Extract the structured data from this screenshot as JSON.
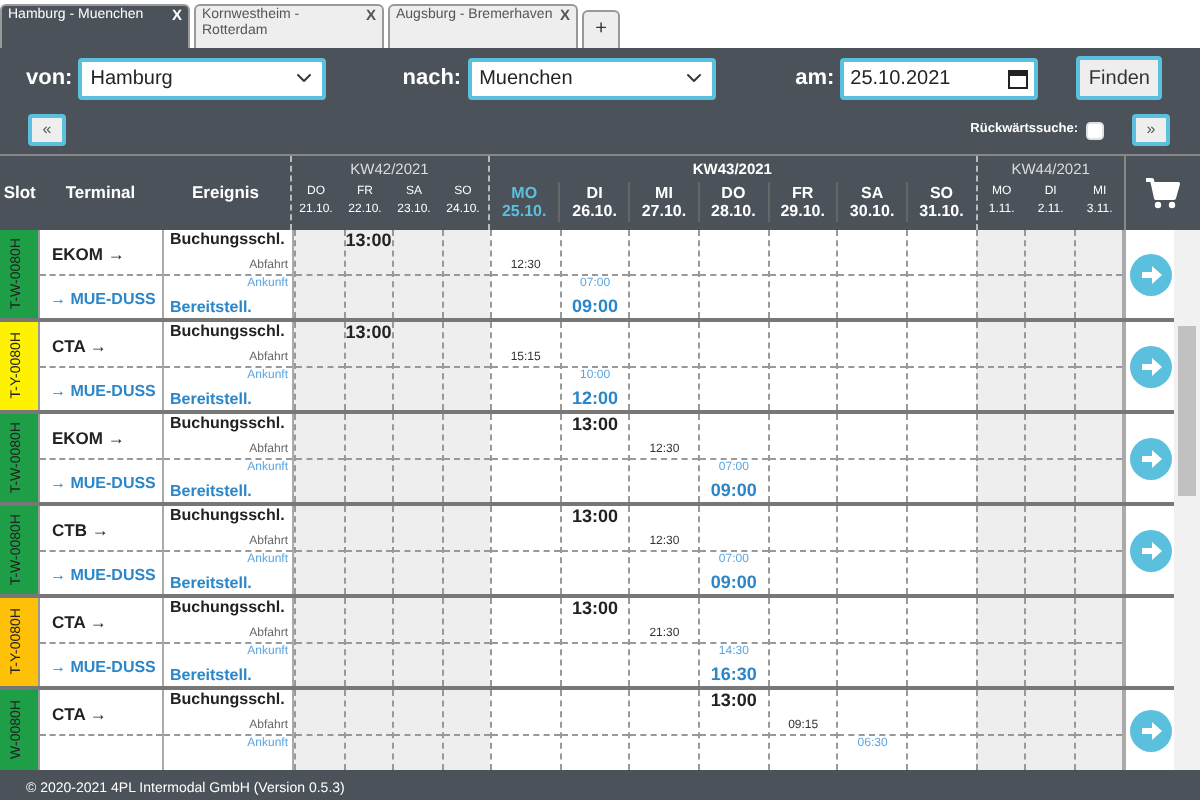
{
  "tabs": [
    {
      "label": "Hamburg - Muenchen",
      "close": "X",
      "selected": true
    },
    {
      "label": "Kornwestheim - Rotterdam",
      "close": "X",
      "selected": false
    },
    {
      "label": "Augsburg - Bremerhaven",
      "close": "X",
      "selected": false
    }
  ],
  "add_tab": "+",
  "search": {
    "from_label": "von:",
    "from": "Hamburg",
    "to_label": "nach:",
    "to": "Muenchen",
    "date_label": "am:",
    "date": "25.10.2021",
    "find_button": "Finden",
    "prev_button": "«",
    "next_button": "»",
    "backward_label": "Rückwärtssuche:",
    "backward_checked": false
  },
  "table": {
    "columns": [
      "Slot",
      "Terminal",
      "Ereignis"
    ],
    "weeks": [
      {
        "label": "KW42/2021",
        "current": false,
        "days": [
          {
            "name": "DO",
            "date": "21.10.",
            "today": false
          },
          {
            "name": "FR",
            "date": "22.10.",
            "today": false
          },
          {
            "name": "SA",
            "date": "23.10.",
            "today": false
          },
          {
            "name": "SO",
            "date": "24.10.",
            "today": false
          }
        ]
      },
      {
        "label": "KW43/2021",
        "current": true,
        "days": [
          {
            "name": "MO",
            "date": "25.10.",
            "today": true
          },
          {
            "name": "DI",
            "date": "26.10.",
            "today": false
          },
          {
            "name": "MI",
            "date": "27.10.",
            "today": false
          },
          {
            "name": "DO",
            "date": "28.10.",
            "today": false
          },
          {
            "name": "FR",
            "date": "29.10.",
            "today": false
          },
          {
            "name": "SA",
            "date": "30.10.",
            "today": false
          },
          {
            "name": "SO",
            "date": "31.10.",
            "today": false
          }
        ]
      },
      {
        "label": "KW44/2021",
        "current": false,
        "days": [
          {
            "name": "MO",
            "date": "1.11.",
            "today": false
          },
          {
            "name": "DI",
            "date": "2.11.",
            "today": false
          },
          {
            "name": "MI",
            "date": "3.11.",
            "today": false
          }
        ]
      }
    ],
    "rows": [
      {
        "slot": "T-W-0080H",
        "color": "#1e9e46",
        "from": "EKOM →",
        "to": "→ MUE-DUSS",
        "book_button": true,
        "events": [
          {
            "kind": "booking",
            "label": "Buchungsschl."
          },
          {
            "kind": "departure",
            "label": "Abfahrt"
          },
          {
            "kind": "arrival",
            "label": "Ankunft"
          },
          {
            "kind": "ready",
            "label": "Bereitstell."
          }
        ],
        "days": [
          {
            "kind": "blank"
          },
          {
            "kind": "times",
            "booking": "13:00"
          },
          {
            "kind": "blank"
          },
          {
            "kind": "blank"
          },
          {
            "kind": "times",
            "departure": "12:30"
          },
          {
            "kind": "times",
            "arrival": "07:00",
            "ready": "09:00"
          },
          {
            "kind": "blank"
          },
          {
            "kind": "blank"
          },
          {
            "kind": "blank"
          },
          {
            "kind": "blank"
          },
          {
            "kind": "blank"
          },
          {
            "kind": "blank"
          },
          {
            "kind": "blank"
          },
          {
            "kind": "blank"
          }
        ]
      },
      {
        "slot": "T-Y-0080H",
        "color": "#fff200",
        "from": "CTA →",
        "to": "→ MUE-DUSS",
        "book_button": true,
        "events": [
          {
            "kind": "booking",
            "label": "Buchungsschl."
          },
          {
            "kind": "departure",
            "label": "Abfahrt"
          },
          {
            "kind": "arrival",
            "label": "Ankunft"
          },
          {
            "kind": "ready",
            "label": "Bereitstell."
          }
        ],
        "days": [
          {
            "kind": "blank"
          },
          {
            "kind": "times",
            "booking": "13:00"
          },
          {
            "kind": "blank"
          },
          {
            "kind": "blank"
          },
          {
            "kind": "times",
            "departure": "15:15"
          },
          {
            "kind": "times",
            "arrival": "10:00",
            "ready": "12:00"
          },
          {
            "kind": "blank"
          },
          {
            "kind": "blank"
          },
          {
            "kind": "blank"
          },
          {
            "kind": "blank"
          },
          {
            "kind": "blank"
          },
          {
            "kind": "blank"
          },
          {
            "kind": "blank"
          },
          {
            "kind": "blank"
          }
        ]
      },
      {
        "slot": "T-W-0080H",
        "color": "#1e9e46",
        "from": "EKOM →",
        "to": "→ MUE-DUSS",
        "book_button": true,
        "events": [
          {
            "kind": "booking",
            "label": "Buchungsschl."
          },
          {
            "kind": "departure",
            "label": "Abfahrt"
          },
          {
            "kind": "arrival",
            "label": "Ankunft"
          },
          {
            "kind": "ready",
            "label": "Bereitstell."
          }
        ],
        "days": [
          {
            "kind": "blank"
          },
          {
            "kind": "blank"
          },
          {
            "kind": "blank"
          },
          {
            "kind": "blank"
          },
          {
            "kind": "blank"
          },
          {
            "kind": "times",
            "booking": "13:00"
          },
          {
            "kind": "times",
            "departure": "12:30"
          },
          {
            "kind": "times",
            "arrival": "07:00",
            "ready": "09:00"
          },
          {
            "kind": "blank"
          },
          {
            "kind": "blank"
          },
          {
            "kind": "blank"
          },
          {
            "kind": "blank"
          },
          {
            "kind": "blank"
          },
          {
            "kind": "blank"
          }
        ]
      },
      {
        "slot": "T-W-0080H",
        "color": "#1e9e46",
        "from": "CTB →",
        "to": "→ MUE-DUSS",
        "book_button": true,
        "events": [
          {
            "kind": "booking",
            "label": "Buchungsschl."
          },
          {
            "kind": "departure",
            "label": "Abfahrt"
          },
          {
            "kind": "arrival",
            "label": "Ankunft"
          },
          {
            "kind": "ready",
            "label": "Bereitstell."
          }
        ],
        "days": [
          {
            "kind": "blank"
          },
          {
            "kind": "blank"
          },
          {
            "kind": "blank"
          },
          {
            "kind": "blank"
          },
          {
            "kind": "blank"
          },
          {
            "kind": "times",
            "booking": "13:00"
          },
          {
            "kind": "times",
            "departure": "12:30"
          },
          {
            "kind": "times",
            "arrival": "07:00",
            "ready": "09:00"
          },
          {
            "kind": "blank"
          },
          {
            "kind": "blank"
          },
          {
            "kind": "blank"
          },
          {
            "kind": "blank"
          },
          {
            "kind": "blank"
          },
          {
            "kind": "blank"
          }
        ]
      },
      {
        "slot": "T-Y-0080H",
        "color": "#ffc107",
        "from": "CTA →",
        "to": "→ MUE-DUSS",
        "book_button": false,
        "events": [
          {
            "kind": "booking",
            "label": "Buchungsschl."
          },
          {
            "kind": "departure",
            "label": "Abfahrt"
          },
          {
            "kind": "arrival",
            "label": "Ankunft"
          },
          {
            "kind": "ready",
            "label": "Bereitstell."
          }
        ],
        "days": [
          {
            "kind": "blank"
          },
          {
            "kind": "blank"
          },
          {
            "kind": "blank"
          },
          {
            "kind": "blank"
          },
          {
            "kind": "blank"
          },
          {
            "kind": "times",
            "booking": "13:00"
          },
          {
            "kind": "times",
            "departure": "21:30"
          },
          {
            "kind": "times",
            "arrival": "14:30",
            "ready": "16:30"
          },
          {
            "kind": "blank"
          },
          {
            "kind": "blank"
          },
          {
            "kind": "blank"
          },
          {
            "kind": "blank"
          },
          {
            "kind": "blank"
          },
          {
            "kind": "blank"
          }
        ]
      },
      {
        "slot": "W-0080H",
        "color": "#1e9e46",
        "from": "CTA →",
        "book_button": true,
        "events": [
          {
            "kind": "booking",
            "label": "Buchungsschl."
          },
          {
            "kind": "departure",
            "label": "Abfahrt"
          },
          {
            "kind": "arrival",
            "label": "Ankunft"
          }
        ],
        "days": [
          {
            "kind": "blank"
          },
          {
            "kind": "blank"
          },
          {
            "kind": "blank"
          },
          {
            "kind": "blank"
          },
          {
            "kind": "blank"
          },
          {
            "kind": "blank"
          },
          {
            "kind": "blank"
          },
          {
            "kind": "times",
            "booking": "13:00"
          },
          {
            "kind": "times",
            "departure": "09:15"
          },
          {
            "kind": "times",
            "arrival": "06:30"
          },
          {
            "kind": "blank"
          },
          {
            "kind": "blank"
          },
          {
            "kind": "blank"
          },
          {
            "kind": "blank"
          }
        ]
      }
    ]
  },
  "footer": "© 2020-2021 4PL Intermodal GmbH (Version 0.5.3)"
}
